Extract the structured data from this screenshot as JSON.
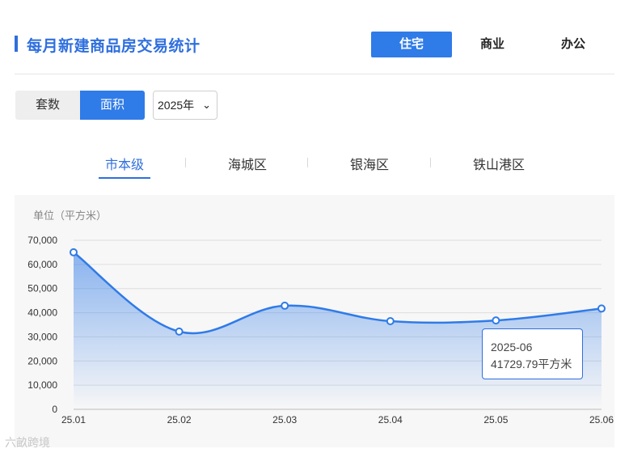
{
  "header": {
    "title": "每月新建商品房交易统计",
    "tabs": [
      {
        "label": "住宅",
        "active": true
      },
      {
        "label": "商业",
        "active": false
      },
      {
        "label": "办公",
        "active": false
      }
    ]
  },
  "controls": {
    "toggle_count": "套数",
    "toggle_area": "面积",
    "toggle_selected": "面积",
    "year": "2025年"
  },
  "districts": [
    {
      "label": "市本级",
      "active": true
    },
    {
      "label": "海城区",
      "active": false
    },
    {
      "label": "银海区",
      "active": false
    },
    {
      "label": "铁山港区",
      "active": false
    }
  ],
  "unit_label": "单位（平方米）",
  "tooltip": {
    "period": "2025-06",
    "value": "41729.79平方米"
  },
  "watermark": "六畝跨境",
  "colors": {
    "accent": "#2f7be8",
    "line": "#2f7be8",
    "title": "#2f6fde"
  },
  "chart_data": {
    "type": "area",
    "categories": [
      "25.01",
      "25.02",
      "25.03",
      "25.04",
      "25.05",
      "25.06"
    ],
    "series": [
      {
        "values": [
          65000,
          32200,
          42900,
          36500,
          36800,
          41729.79
        ]
      }
    ],
    "yticks": [
      "0",
      "10,000",
      "20,000",
      "30,000",
      "40,000",
      "50,000",
      "60,000",
      "70,000"
    ],
    "ylim": [
      0,
      70000
    ],
    "grid": true,
    "smooth": true
  }
}
